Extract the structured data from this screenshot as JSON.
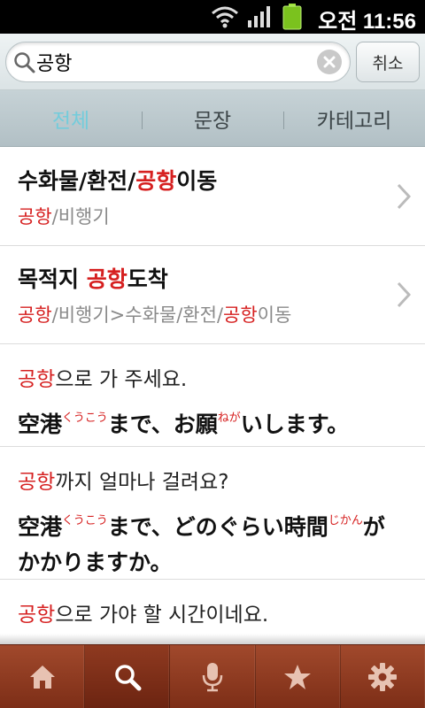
{
  "status_bar": {
    "time": "오전 11:56"
  },
  "search": {
    "query": "공항",
    "cancel_label": "취소"
  },
  "tabs": [
    {
      "label": "전체",
      "active": true
    },
    {
      "label": "문장",
      "active": false
    },
    {
      "label": "카테고리",
      "active": false
    }
  ],
  "results": {
    "categories": [
      {
        "title_prefix": "수화물/환전/",
        "title_hl": "공항",
        "title_suffix": "이동",
        "path_hl": "공항",
        "path_rest": "/비행기"
      },
      {
        "title_prefix": "목적지 ",
        "title_hl": "공항",
        "title_suffix": "도착",
        "path_hl": "공항",
        "path_mid": "/비행기>수화물/환전/",
        "path_hl2": "공항",
        "path_end": "이동"
      }
    ],
    "sentences": [
      {
        "ko_hl": "공항",
        "ko_rest": "으로 가 주세요.",
        "ja_a": "空港",
        "ja_a_ruby": "くうこう",
        "ja_b": "まで、お願",
        "ja_b_ruby": "ねが",
        "ja_c": "いします。"
      },
      {
        "ko_hl": "공항",
        "ko_rest": "까지 얼마나 걸려요?",
        "ja_a": "空港",
        "ja_a_ruby": "くうこう",
        "ja_b": "まで、どのぐらい時間",
        "ja_b_ruby": "じかん",
        "ja_c": "がかかりますか。"
      },
      {
        "ko_hl": "공항",
        "ko_rest": "으로 가야 할 시간이네요."
      }
    ]
  },
  "bottom_nav": [
    {
      "icon": "home-icon",
      "active": false
    },
    {
      "icon": "search-icon",
      "active": true
    },
    {
      "icon": "microphone-icon",
      "active": false
    },
    {
      "icon": "star-icon",
      "active": false
    },
    {
      "icon": "gear-icon",
      "active": false
    }
  ],
  "colors": {
    "highlight": "#d62020",
    "active_tab": "#74ccdb",
    "bottom_bar": "#8f3a20"
  }
}
